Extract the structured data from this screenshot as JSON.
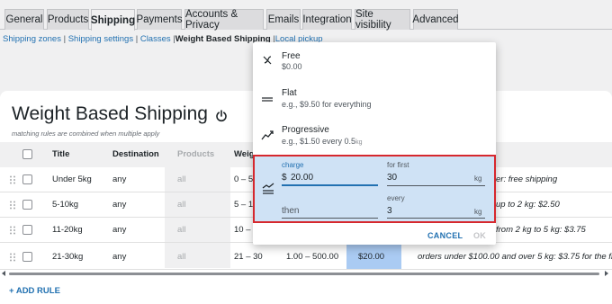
{
  "tabs": [
    {
      "label": "General",
      "active": false
    },
    {
      "label": "Products",
      "active": false
    },
    {
      "label": "Shipping",
      "active": true
    },
    {
      "label": "Payments",
      "active": false
    },
    {
      "label": "Accounts & Privacy",
      "active": false
    },
    {
      "label": "Emails",
      "active": false
    },
    {
      "label": "Integration",
      "active": false
    },
    {
      "label": "Site visibility",
      "active": false
    },
    {
      "label": "Advanced",
      "active": false
    }
  ],
  "subnav": {
    "shipping_zones": "Shipping zones",
    "shipping_settings": "Shipping settings",
    "classes": "Classes",
    "current": "Weight Based Shipping",
    "local_pickup": "Local pickup",
    "separator": "|"
  },
  "page": {
    "title": "Weight Based Shipping",
    "subtitle": "matching rules are combined when multiple apply"
  },
  "table": {
    "columns": [
      "Title",
      "Destination",
      "Products",
      "Weig"
    ],
    "rows": [
      {
        "title": "Under 5kg",
        "destination": "any",
        "products": "all",
        "weight": "0 – 5",
        "note": "er: free shipping"
      },
      {
        "title": "5-10kg",
        "destination": "any",
        "products": "all",
        "weight": "5 – 1",
        "note": "up to 2 kg: $2.50"
      },
      {
        "title": "11-20kg",
        "destination": "any",
        "products": "all",
        "weight": "10 –",
        "note": "from 2 kg to 5 kg: $3.75"
      },
      {
        "title": "21-30kg",
        "destination": "any",
        "products": "all",
        "weight": "21 – 30",
        "subtotal": "1.00 – 500.00",
        "price": "$20.00",
        "note": "orders under $100.00 and over 5 kg: $3.75 for the first 5 kg"
      }
    ]
  },
  "add_rule": "+ ADD RULE",
  "popup": {
    "options": [
      {
        "title": "Free",
        "desc": "$0.00",
        "icon": "free-shipping-icon"
      },
      {
        "title": "Flat",
        "desc": "e.g., $9.50 for everything",
        "icon": "flat-rate-icon"
      },
      {
        "title": "Progressive",
        "desc": "e.g., $1.50 every 0.5",
        "desc_unit": "kg",
        "icon": "progressive-icon"
      }
    ],
    "custom": {
      "icon": "custom-rate-icon",
      "charge_label": "charge",
      "currency": "$",
      "charge_value": "20.00",
      "for_first_label": "for first",
      "for_first_value": "30",
      "then_label": "then",
      "every_label": "every",
      "every_value": "3",
      "unit": "kg"
    },
    "cancel": "CANCEL",
    "ok": "OK"
  },
  "colors": {
    "accent": "#2271b1",
    "selected_bg": "#cfe2f5",
    "highlight_border": "#d6282e",
    "price_cell": "#aacbf3"
  }
}
